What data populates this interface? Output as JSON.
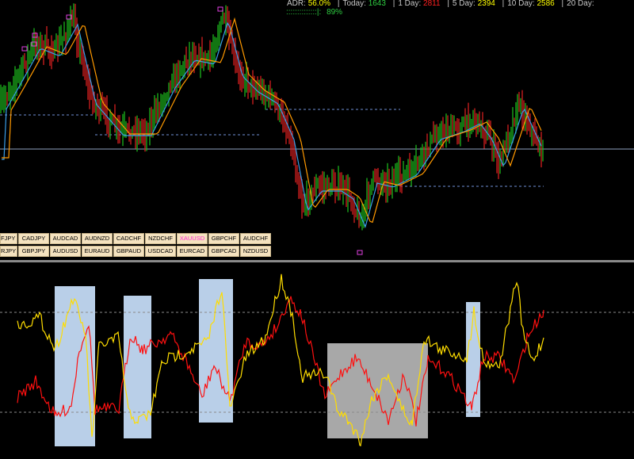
{
  "stats": {
    "adr_label": "ADR:",
    "adr_value": "56.0%",
    "today_label": "Today:",
    "today_value": "1643",
    "day1_label": "1 Day:",
    "day1_value": "2811",
    "day5_label": "5 Day:",
    "day5_value": "2394",
    "day10_label": "10 Day:",
    "day10_value": "2586",
    "day20_label": "20 Day:",
    "meter_bar": "::::::::::::::|:",
    "meter_value": "89%"
  },
  "colors": {
    "adr": "#ffff00",
    "today": "#2ecc40",
    "day1": "#ff2020",
    "day5": "#ffff00",
    "day10": "#ffff00",
    "bull_bar": "#1db41d",
    "bear_bar": "#d42020",
    "fast_ma": "#3a9ee8",
    "slow_ma": "#ff9900",
    "osc_red": "#ff1010",
    "osc_yellow": "#ffdd00",
    "highlight_blue": "#b9cfe8",
    "highlight_gray": "#a8a8a8"
  },
  "pair_rows": [
    [
      "FJPY",
      "CADJPY",
      "AUDCAD",
      "AUDNZD",
      "CADCHF",
      "NZDCHF",
      "XAUUSD",
      "GBPCHF",
      "AUDCHF"
    ],
    [
      "RJPY",
      "GBPJPY",
      "AUDUSD",
      "EURAUD",
      "GBPAUD",
      "USDCAD",
      "EURCAD",
      "GBPCAD",
      "NZDUSD"
    ]
  ],
  "active_pair": "XAUUSD"
}
